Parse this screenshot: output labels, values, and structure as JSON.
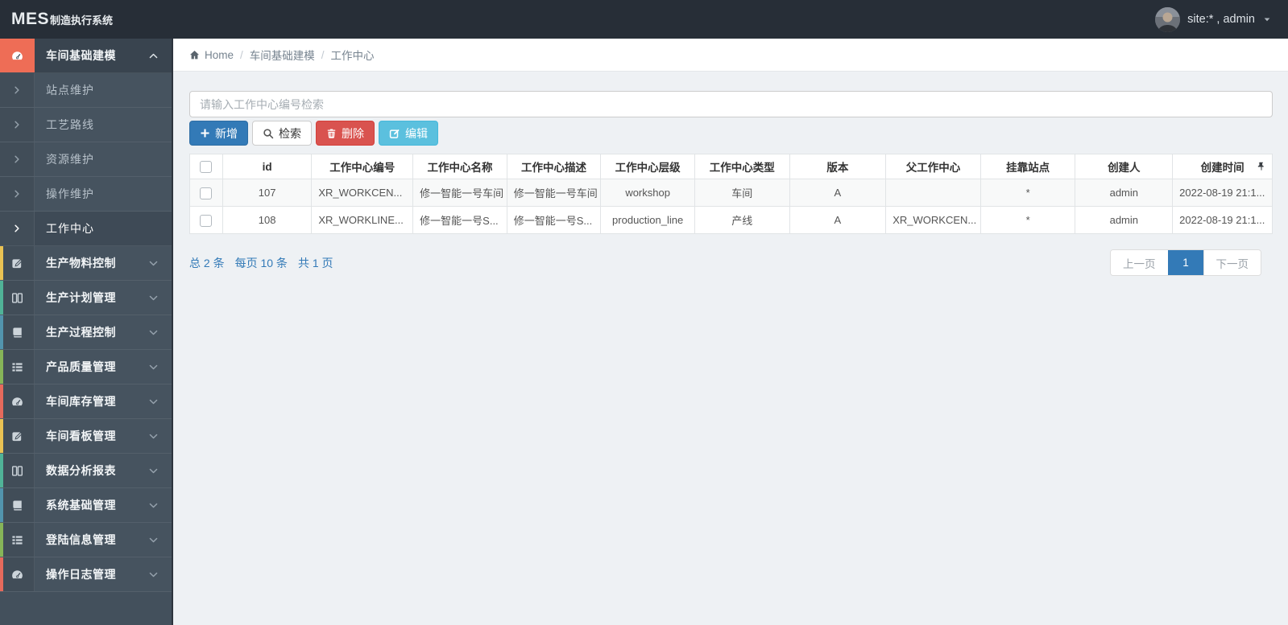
{
  "navbar": {
    "logo_bold": "MES",
    "logo_text": "制造执行系统",
    "user_label": "site:* , admin"
  },
  "breadcrumb": {
    "items": [
      {
        "label": "Home",
        "icon": "home-icon",
        "clickable": true
      },
      {
        "label": "车间基础建模",
        "clickable": true
      },
      {
        "label": "工作中心",
        "clickable": false
      }
    ]
  },
  "sidebar": {
    "items": [
      {
        "label": "车间基础建模",
        "icon": "gauge-icon",
        "accent": "#ee6d56",
        "expanded": true,
        "active": true,
        "children": [
          {
            "label": "站点维护"
          },
          {
            "label": "工艺路线"
          },
          {
            "label": "资源维护"
          },
          {
            "label": "操作维护"
          },
          {
            "label": "工作中心",
            "active": true
          }
        ]
      },
      {
        "label": "生产物料控制",
        "icon": "edit-square-icon",
        "accent": "#e9c253"
      },
      {
        "label": "生产计划管理",
        "icon": "columns-icon",
        "accent": "#50b397"
      },
      {
        "label": "生产过程控制",
        "icon": "book-icon",
        "accent": "#5294ad"
      },
      {
        "label": "产品质量管理",
        "icon": "list-icon",
        "accent": "#86b558"
      },
      {
        "label": "车间库存管理",
        "icon": "gauge-icon",
        "accent": "#e66a5c"
      },
      {
        "label": "车间看板管理",
        "icon": "edit-square-icon",
        "accent": "#e9c253"
      },
      {
        "label": "数据分析报表",
        "icon": "columns-icon",
        "accent": "#50b397"
      },
      {
        "label": "系统基础管理",
        "icon": "book-icon",
        "accent": "#5294ad"
      },
      {
        "label": "登陆信息管理",
        "icon": "list-icon",
        "accent": "#86b558"
      },
      {
        "label": "操作日志管理",
        "icon": "gauge-icon",
        "accent": "#e66a5c"
      }
    ]
  },
  "toolbar": {
    "search_placeholder": "请输入工作中心编号检索",
    "buttons": [
      {
        "label": "新增",
        "icon": "plus-icon",
        "style": "primary",
        "name": "add-button"
      },
      {
        "label": "检索",
        "icon": "search-icon",
        "style": "default",
        "name": "search-button"
      },
      {
        "label": "删除",
        "icon": "trash-icon",
        "style": "danger",
        "name": "delete-button"
      },
      {
        "label": "编辑",
        "icon": "edit-icon",
        "style": "info",
        "name": "edit-button"
      }
    ]
  },
  "table": {
    "columns": [
      "id",
      "工作中心编号",
      "工作中心名称",
      "工作中心描述",
      "工作中心层级",
      "工作中心类型",
      "版本",
      "父工作中心",
      "挂靠站点",
      "创建人",
      "创建时间"
    ],
    "rows": [
      [
        "107",
        "XR_WORKCEN...",
        "修一智能一号车间",
        "修一智能一号车间",
        "workshop",
        "车间",
        "A",
        "",
        "*",
        "admin",
        "2022-08-19 21:1..."
      ],
      [
        "108",
        "XR_WORKLINE...",
        "修一智能一号S...",
        "修一智能一号S...",
        "production_line",
        "产线",
        "A",
        "XR_WORKCEN...",
        "*",
        "admin",
        "2022-08-19 21:1..."
      ]
    ]
  },
  "pagination": {
    "total": "总 2 条",
    "per_page": "每页 10 条",
    "pages": "共 1 页",
    "prev": "上一页",
    "current": "1",
    "next": "下一页"
  },
  "colors": {
    "accent_blue": "#337ab7",
    "danger_red": "#d9534f",
    "info_cyan": "#5bc0de",
    "active_salmon": "#ee6d56",
    "sidebar_slate": "#46535f",
    "navbar_dark": "#272e37"
  }
}
